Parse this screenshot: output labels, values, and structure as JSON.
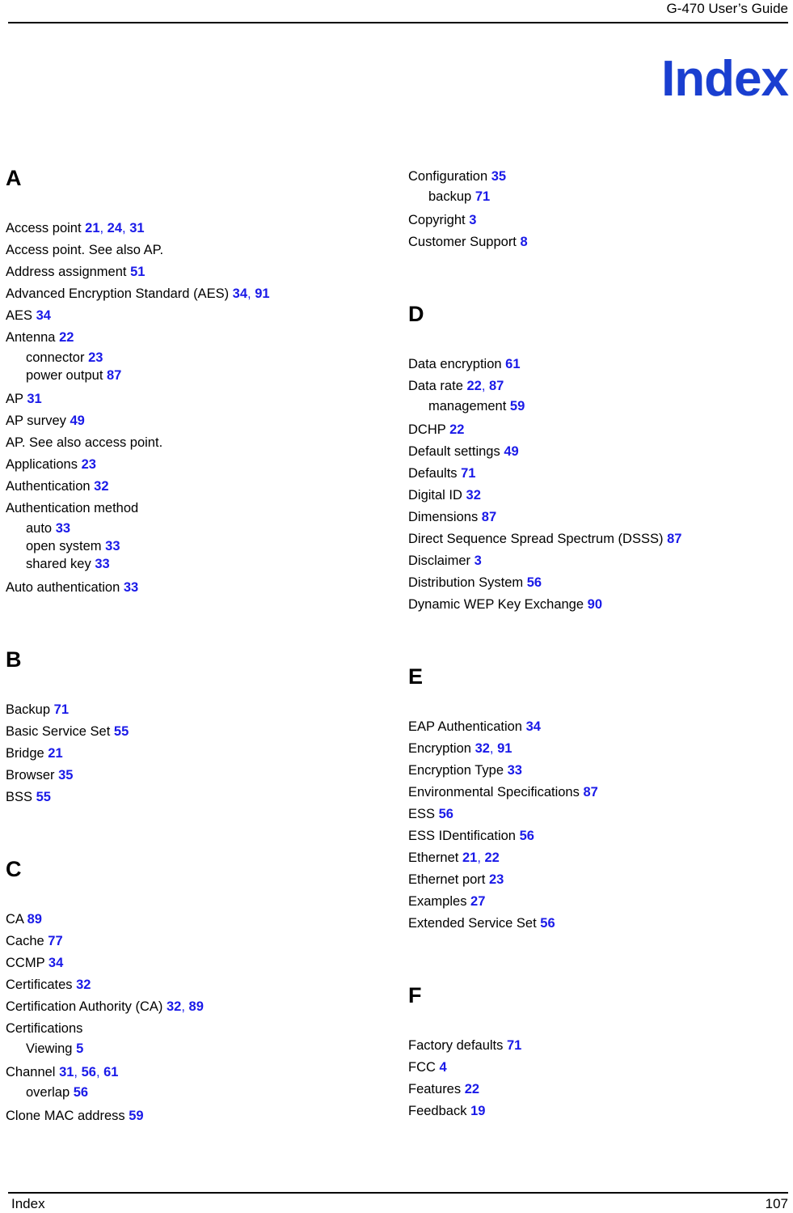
{
  "header": {
    "title": "G-470 User’s Guide"
  },
  "title": "Index",
  "colors": {
    "page_number_blue": "#1a1ae8",
    "heading_blue": "#1a3fd0",
    "text_black": "#000000"
  },
  "footer": {
    "label": "Index",
    "page_number": "107"
  },
  "columns": [
    {
      "id": "left",
      "sections": [
        {
          "letter": "A",
          "entries": [
            {
              "level": "main",
              "text": "Access point",
              "pages": [
                "21",
                "24",
                "31"
              ]
            },
            {
              "level": "main",
              "text": "Access point. See also AP.",
              "pages": []
            },
            {
              "level": "main",
              "text": "Address assignment",
              "pages": [
                "51"
              ]
            },
            {
              "level": "main",
              "text": "Advanced Encryption Standard (AES)",
              "pages": [
                "34",
                "91"
              ]
            },
            {
              "level": "main",
              "text": "AES",
              "pages": [
                "34"
              ]
            },
            {
              "level": "main",
              "text": "Antenna",
              "pages": [
                "22"
              ]
            },
            {
              "level": "sub",
              "text": "connector",
              "pages": [
                "23"
              ]
            },
            {
              "level": "sub",
              "text": "power output",
              "pages": [
                "87"
              ]
            },
            {
              "level": "main",
              "text": "AP",
              "pages": [
                "31"
              ]
            },
            {
              "level": "main",
              "text": "AP survey",
              "pages": [
                "49"
              ]
            },
            {
              "level": "main",
              "text": "AP. See also access point.",
              "pages": []
            },
            {
              "level": "main",
              "text": "Applications",
              "pages": [
                "23"
              ]
            },
            {
              "level": "main",
              "text": "Authentication",
              "pages": [
                "32"
              ]
            },
            {
              "level": "main",
              "text": "Authentication method",
              "pages": []
            },
            {
              "level": "sub",
              "text": "auto",
              "pages": [
                "33"
              ]
            },
            {
              "level": "sub",
              "text": "open system",
              "pages": [
                "33"
              ]
            },
            {
              "level": "sub",
              "text": "shared key",
              "pages": [
                "33"
              ]
            },
            {
              "level": "main",
              "text": "Auto authentication",
              "pages": [
                "33"
              ]
            }
          ]
        },
        {
          "letter": "B",
          "entries": [
            {
              "level": "main",
              "text": "Backup",
              "pages": [
                "71"
              ]
            },
            {
              "level": "main",
              "text": "Basic Service Set",
              "pages": [
                "55"
              ]
            },
            {
              "level": "main",
              "text": "Bridge",
              "pages": [
                "21"
              ]
            },
            {
              "level": "main",
              "text": "Browser",
              "pages": [
                "35"
              ]
            },
            {
              "level": "main",
              "text": "BSS",
              "pages": [
                "55"
              ]
            }
          ]
        },
        {
          "letter": "C",
          "entries": [
            {
              "level": "main",
              "text": "CA",
              "pages": [
                "89"
              ]
            },
            {
              "level": "main",
              "text": "Cache",
              "pages": [
                "77"
              ]
            },
            {
              "level": "main",
              "text": "CCMP",
              "pages": [
                "34"
              ]
            },
            {
              "level": "main",
              "text": "Certificates",
              "pages": [
                "32"
              ]
            },
            {
              "level": "main",
              "text": "Certification Authority (CA)",
              "pages": [
                "32",
                "89"
              ]
            },
            {
              "level": "main",
              "text": "Certifications",
              "pages": []
            },
            {
              "level": "sub",
              "text": "Viewing",
              "pages": [
                "5"
              ]
            },
            {
              "level": "main",
              "text": "Channel",
              "pages": [
                "31",
                "56",
                "61"
              ]
            },
            {
              "level": "sub",
              "text": "overlap",
              "pages": [
                "56"
              ]
            },
            {
              "level": "main",
              "text": "Clone MAC address",
              "pages": [
                "59"
              ]
            }
          ]
        }
      ]
    },
    {
      "id": "right",
      "sections": [
        {
          "letter": "",
          "entries": [
            {
              "level": "main",
              "text": "Configuration",
              "pages": [
                "35"
              ]
            },
            {
              "level": "sub",
              "text": "backup",
              "pages": [
                "71"
              ]
            },
            {
              "level": "main",
              "text": "Copyright",
              "pages": [
                "3"
              ]
            },
            {
              "level": "main",
              "text": "Customer Support",
              "pages": [
                "8"
              ]
            }
          ]
        },
        {
          "letter": "D",
          "entries": [
            {
              "level": "main",
              "text": "Data encryption",
              "pages": [
                "61"
              ]
            },
            {
              "level": "main",
              "text": "Data rate",
              "pages": [
                "22",
                "87"
              ]
            },
            {
              "level": "sub",
              "text": "management",
              "pages": [
                "59"
              ]
            },
            {
              "level": "main",
              "text": "DCHP",
              "pages": [
                "22"
              ]
            },
            {
              "level": "main",
              "text": "Default settings",
              "pages": [
                "49"
              ]
            },
            {
              "level": "main",
              "text": "Defaults",
              "pages": [
                "71"
              ]
            },
            {
              "level": "main",
              "text": "Digital ID",
              "pages": [
                "32"
              ]
            },
            {
              "level": "main",
              "text": "Dimensions",
              "pages": [
                "87"
              ]
            },
            {
              "level": "main",
              "text": "Direct Sequence Spread Spectrum (DSSS)",
              "pages": [
                "87"
              ]
            },
            {
              "level": "main",
              "text": "Disclaimer",
              "pages": [
                "3"
              ]
            },
            {
              "level": "main",
              "text": "Distribution System",
              "pages": [
                "56"
              ]
            },
            {
              "level": "main",
              "text": "Dynamic WEP Key Exchange",
              "pages": [
                "90"
              ]
            }
          ]
        },
        {
          "letter": "E",
          "entries": [
            {
              "level": "main",
              "text": "EAP Authentication",
              "pages": [
                "34"
              ]
            },
            {
              "level": "main",
              "text": "Encryption",
              "pages": [
                "32",
                "91"
              ]
            },
            {
              "level": "main",
              "text": "Encryption Type",
              "pages": [
                "33"
              ]
            },
            {
              "level": "main",
              "text": "Environmental Specifications",
              "pages": [
                "87"
              ]
            },
            {
              "level": "main",
              "text": "ESS",
              "pages": [
                "56"
              ]
            },
            {
              "level": "main",
              "text": "ESS IDentification",
              "pages": [
                "56"
              ]
            },
            {
              "level": "main",
              "text": "Ethernet",
              "pages": [
                "21",
                "22"
              ]
            },
            {
              "level": "main",
              "text": "Ethernet port",
              "pages": [
                "23"
              ]
            },
            {
              "level": "main",
              "text": "Examples",
              "pages": [
                "27"
              ]
            },
            {
              "level": "main",
              "text": "Extended Service Set",
              "pages": [
                "56"
              ]
            }
          ]
        },
        {
          "letter": "F",
          "entries": [
            {
              "level": "main",
              "text": "Factory defaults",
              "pages": [
                "71"
              ]
            },
            {
              "level": "main",
              "text": "FCC",
              "pages": [
                "4"
              ]
            },
            {
              "level": "main",
              "text": "Features",
              "pages": [
                "22"
              ]
            },
            {
              "level": "main",
              "text": "Feedback",
              "pages": [
                "19"
              ]
            }
          ]
        }
      ]
    }
  ]
}
